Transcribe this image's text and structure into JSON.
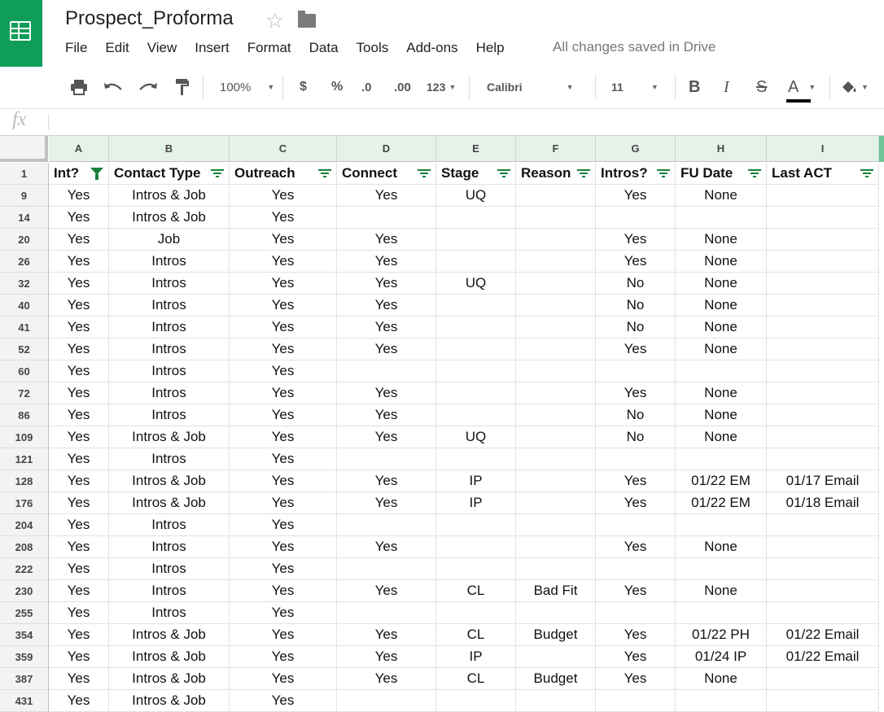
{
  "app": {
    "title": "Prospect_Proforma",
    "star_icon": "star-icon",
    "folder_icon": "folder-icon",
    "saved_status": "All changes saved in Drive",
    "brand_color": "#0f9d58"
  },
  "menu": [
    "File",
    "Edit",
    "View",
    "Insert",
    "Format",
    "Data",
    "Tools",
    "Add-ons",
    "Help"
  ],
  "toolbar": {
    "zoom": "100%",
    "currency": "$",
    "percent": "%",
    "dec_less": ".0",
    "dec_more": ".00",
    "more_formats": "123",
    "font": "Calibri",
    "font_size": "11",
    "bold": "B",
    "italic": "I",
    "strike": "S",
    "text_color": "A"
  },
  "formula_bar": {
    "fx": "fx",
    "value": ""
  },
  "columns": [
    "A",
    "B",
    "C",
    "D",
    "E",
    "F",
    "G",
    "H",
    "I"
  ],
  "header_row": {
    "row_number": "1",
    "cells": [
      "Int?",
      "Contact Type",
      "Outreach",
      "Connect",
      "Stage",
      "Reason",
      "Intros?",
      "FU Date",
      "Last ACT"
    ],
    "active_filter_column": "A"
  },
  "rows": [
    {
      "n": "9",
      "c": [
        "Yes",
        "Intros & Job",
        "Yes",
        "Yes",
        "UQ",
        "",
        "Yes",
        "None",
        ""
      ]
    },
    {
      "n": "14",
      "c": [
        "Yes",
        "Intros & Job",
        "Yes",
        "",
        "",
        "",
        "",
        "",
        ""
      ]
    },
    {
      "n": "20",
      "c": [
        "Yes",
        "Job",
        "Yes",
        "Yes",
        "",
        "",
        "Yes",
        "None",
        ""
      ]
    },
    {
      "n": "26",
      "c": [
        "Yes",
        "Intros",
        "Yes",
        "Yes",
        "",
        "",
        "Yes",
        "None",
        ""
      ]
    },
    {
      "n": "32",
      "c": [
        "Yes",
        "Intros",
        "Yes",
        "Yes",
        "UQ",
        "",
        "No",
        "None",
        ""
      ]
    },
    {
      "n": "40",
      "c": [
        "Yes",
        "Intros",
        "Yes",
        "Yes",
        "",
        "",
        "No",
        "None",
        ""
      ]
    },
    {
      "n": "41",
      "c": [
        "Yes",
        "Intros",
        "Yes",
        "Yes",
        "",
        "",
        "No",
        "None",
        ""
      ]
    },
    {
      "n": "52",
      "c": [
        "Yes",
        "Intros",
        "Yes",
        "Yes",
        "",
        "",
        "Yes",
        "None",
        ""
      ]
    },
    {
      "n": "60",
      "c": [
        "Yes",
        "Intros",
        "Yes",
        "",
        "",
        "",
        "",
        "",
        ""
      ]
    },
    {
      "n": "72",
      "c": [
        "Yes",
        "Intros",
        "Yes",
        "Yes",
        "",
        "",
        "Yes",
        "None",
        ""
      ]
    },
    {
      "n": "86",
      "c": [
        "Yes",
        "Intros",
        "Yes",
        "Yes",
        "",
        "",
        "No",
        "None",
        ""
      ]
    },
    {
      "n": "109",
      "c": [
        "Yes",
        "Intros & Job",
        "Yes",
        "Yes",
        "UQ",
        "",
        "No",
        "None",
        ""
      ]
    },
    {
      "n": "121",
      "c": [
        "Yes",
        "Intros",
        "Yes",
        "",
        "",
        "",
        "",
        "",
        ""
      ]
    },
    {
      "n": "128",
      "c": [
        "Yes",
        "Intros & Job",
        "Yes",
        "Yes",
        "IP",
        "",
        "Yes",
        "01/22 EM",
        "01/17 Email"
      ]
    },
    {
      "n": "176",
      "c": [
        "Yes",
        "Intros & Job",
        "Yes",
        "Yes",
        "IP",
        "",
        "Yes",
        "01/22 EM",
        "01/18 Email"
      ]
    },
    {
      "n": "204",
      "c": [
        "Yes",
        "Intros",
        "Yes",
        "",
        "",
        "",
        "",
        "",
        ""
      ]
    },
    {
      "n": "208",
      "c": [
        "Yes",
        "Intros",
        "Yes",
        "Yes",
        "",
        "",
        "Yes",
        "None",
        ""
      ]
    },
    {
      "n": "222",
      "c": [
        "Yes",
        "Intros",
        "Yes",
        "",
        "",
        "",
        "",
        "",
        ""
      ]
    },
    {
      "n": "230",
      "c": [
        "Yes",
        "Intros",
        "Yes",
        "Yes",
        "CL",
        "Bad Fit",
        "Yes",
        "None",
        ""
      ]
    },
    {
      "n": "255",
      "c": [
        "Yes",
        "Intros",
        "Yes",
        "",
        "",
        "",
        "",
        "",
        ""
      ]
    },
    {
      "n": "354",
      "c": [
        "Yes",
        "Intros & Job",
        "Yes",
        "Yes",
        "CL",
        "Budget",
        "Yes",
        "01/22 PH",
        "01/22 Email"
      ]
    },
    {
      "n": "359",
      "c": [
        "Yes",
        "Intros & Job",
        "Yes",
        "Yes",
        "IP",
        "",
        "Yes",
        "01/24 IP",
        "01/22 Email"
      ]
    },
    {
      "n": "387",
      "c": [
        "Yes",
        "Intros & Job",
        "Yes",
        "Yes",
        "CL",
        "Budget",
        "Yes",
        "None",
        ""
      ]
    },
    {
      "n": "431",
      "c": [
        "Yes",
        "Intros & Job",
        "Yes",
        "",
        "",
        "",
        "",
        "",
        ""
      ]
    }
  ]
}
